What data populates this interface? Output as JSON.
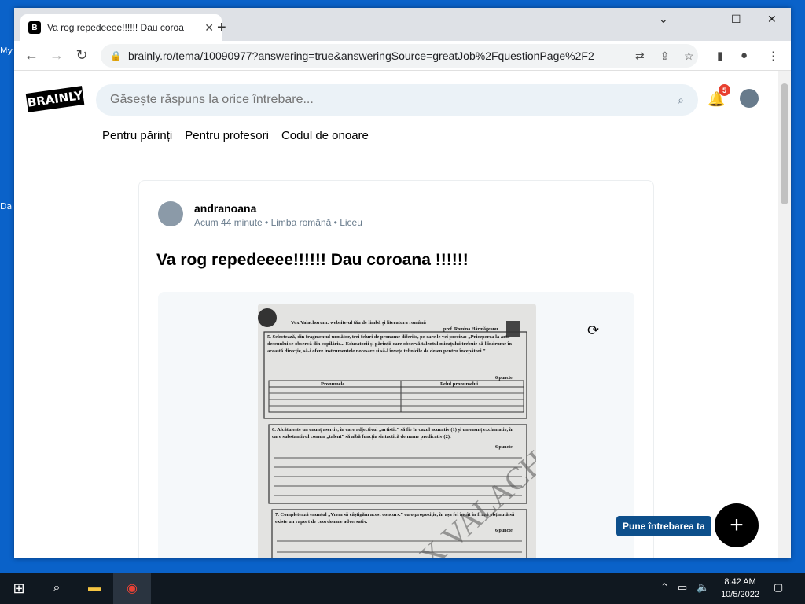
{
  "desktop": {
    "labels": [
      "My",
      "Da"
    ]
  },
  "browser": {
    "tab_title": "Va rog repedeeee!!!!!! Dau coroa",
    "url": "brainly.ro/tema/10090977?answering=true&answeringSource=greatJob%2FquestionPage%2F2"
  },
  "site": {
    "logo": "BRAINLY",
    "search_placeholder": "Găsește răspuns la orice întrebare...",
    "notification_count": "5",
    "nav_links": [
      "Pentru părinți",
      "Pentru profesori",
      "Codul de onoare"
    ]
  },
  "question": {
    "author": "andranoana",
    "time": "Acum 44 minute",
    "subject": "Limba română",
    "level": "Liceu",
    "title": "Va rog repedeeee!!!!!! Dau coroana !!!!!!"
  },
  "worksheet": {
    "header": "Vox Valachorum: website-ul tău de limbă și literatura română",
    "author": "prof. Romina Hărmăgeanu",
    "q5": "5. Selectează, din fragmentul următor, trei feluri de pronume diferite, pe care le vei preciza: „Priceperea la arta desenului se observă din copilărie... Educatorii și părinții care observă talentul micuțului trebuie să-l îndrume în această direcție, să-i ofere instrumentele necesare și să-l învețe tehnicile de desen pentru începători.”.",
    "q5_points": "6 puncte",
    "col1": "Pronumele",
    "col2": "Felul pronumelui",
    "q6": "6. Alcătuiește un enunț asertiv, în care adjectivul „artistic” să fie în cazul acuzativ (1) și un enunț exclamativ, în care substantivul comun „talent” să aibă funcția sintactică de nume predicativ (2).",
    "q6_points": "6 puncte",
    "q7": "7. Completează enunțul „Vrem să câștigăm acest concurs.” cu o propoziție, în așa fel încât în frază obținută să existe un raport de coordonare adversativ.",
    "q7_points": "6 puncte",
    "watermark": "VOX VALACHORUM"
  },
  "ask_button_label": "Pune întrebarea ta",
  "taskbar": {
    "time": "8:42 AM",
    "date": "10/5/2022"
  }
}
